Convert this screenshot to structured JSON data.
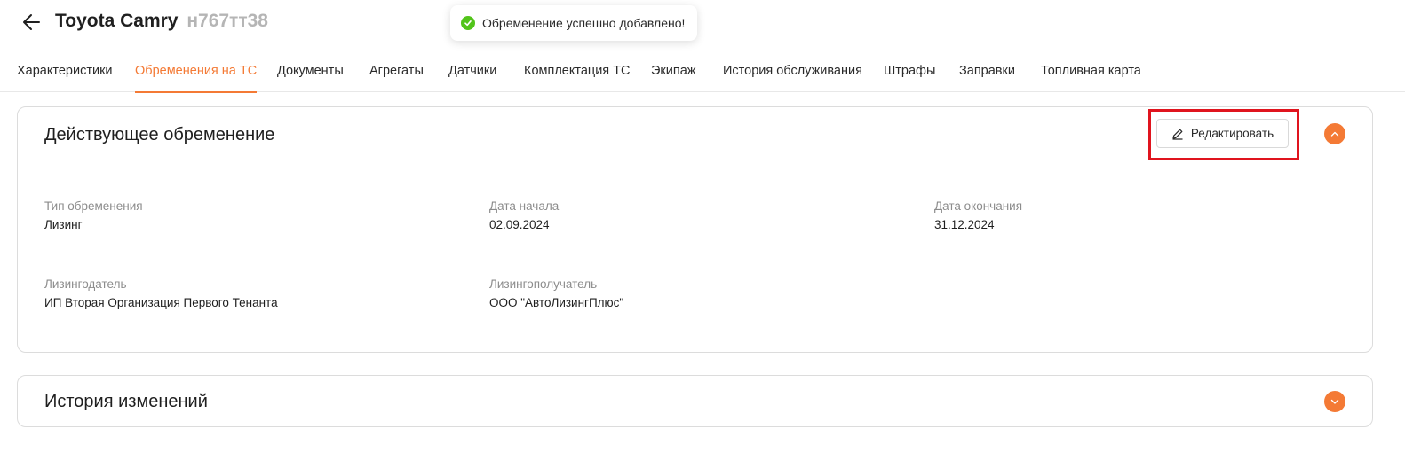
{
  "header": {
    "title": "Toyota Camry",
    "plate": "н767тт38"
  },
  "toast": {
    "message": "Обременение успешно добавлено!",
    "status_color": "#52c41a"
  },
  "tabs": [
    {
      "label": "Характеристики",
      "active": false
    },
    {
      "label": "Обременения на ТС",
      "active": true
    },
    {
      "label": "Документы",
      "active": false
    },
    {
      "label": "Агрегаты",
      "active": false
    },
    {
      "label": "Датчики",
      "active": false
    },
    {
      "label": "Комплектация ТС",
      "active": false
    },
    {
      "label": "Экипаж",
      "active": false
    },
    {
      "label": "История обслуживания",
      "active": false
    },
    {
      "label": "Штрафы",
      "active": false
    },
    {
      "label": "Заправки",
      "active": false
    },
    {
      "label": "Топливная карта",
      "active": false
    }
  ],
  "current_encumbrance": {
    "title": "Действующее обременение",
    "edit_label": "Редактировать",
    "expanded": true,
    "fields": {
      "type": {
        "label": "Тип обременения",
        "value": "Лизинг"
      },
      "start_date": {
        "label": "Дата начала",
        "value": "02.09.2024"
      },
      "end_date": {
        "label": "Дата окончания",
        "value": "31.12.2024"
      },
      "lessor": {
        "label": "Лизингодатель",
        "value": "ИП Вторая Организация Первого Тенанта"
      },
      "lessee": {
        "label": "Лизингополучатель",
        "value": "ООО \"АвтоЛизингПлюс\""
      }
    }
  },
  "history": {
    "title": "История изменений",
    "expanded": false
  },
  "colors": {
    "accent": "#f47a35",
    "highlight": "#e0141e",
    "success": "#52c41a"
  },
  "icons": {
    "back": "arrow-left-icon",
    "edit": "pencil-icon",
    "collapse": "chevron-up-icon",
    "expand": "chevron-down-icon",
    "toast": "check-circle-icon"
  }
}
